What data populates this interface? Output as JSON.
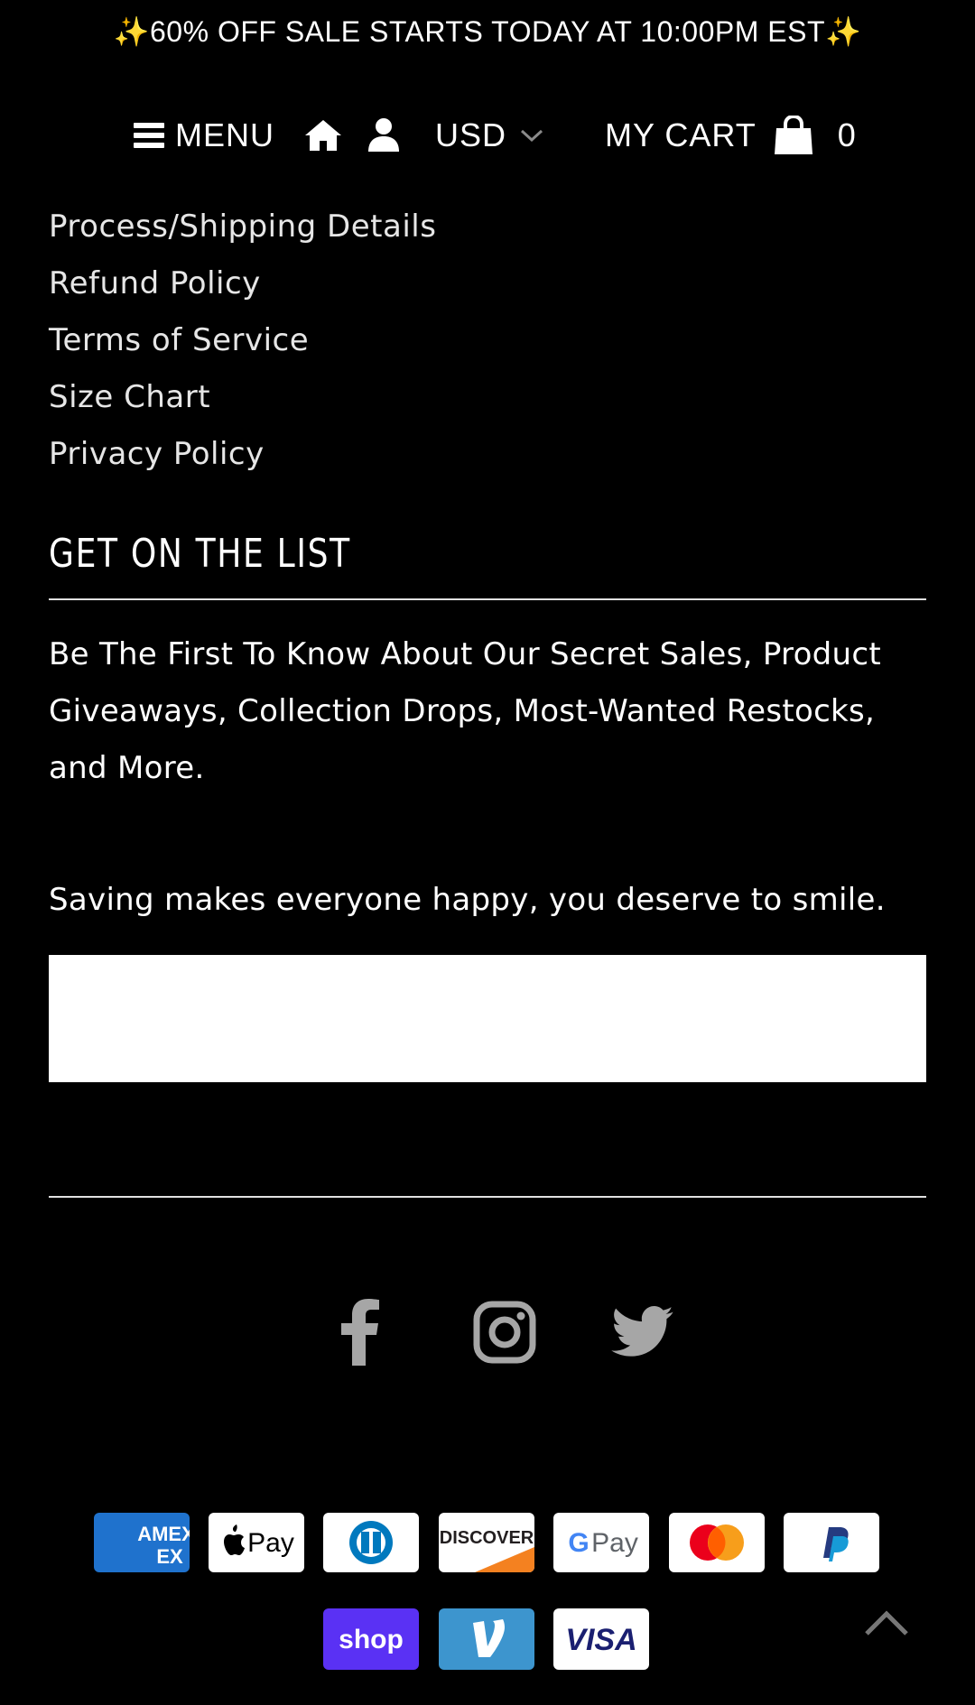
{
  "announcement": {
    "text": "60% OFF SALE STARTS TODAY AT 10:00PM EST",
    "emoji": "✨"
  },
  "header": {
    "menu_label": "MENU",
    "currency": "USD",
    "cart_label": "MY CART",
    "cart_count": "0"
  },
  "footer_links": [
    "Process/Shipping Details",
    "Refund Policy",
    "Terms of Service",
    "Size Chart",
    "Privacy Policy"
  ],
  "newsletter": {
    "title": "GET ON THE LIST",
    "description": "Be The First To Know About Our Secret Sales, Product Giveaways, Collection Drops, Most-Wanted Restocks, and More.",
    "tagline": "Saving makes everyone happy, you deserve to smile.",
    "email_value": ""
  },
  "social": [
    "facebook-icon",
    "instagram-icon",
    "twitter-icon"
  ],
  "payments": {
    "amex": "AMEX",
    "applepay": "Pay",
    "discover": "DISCOVER",
    "googlepay": "Pay",
    "shoppay": "shop",
    "visa": "VISA"
  },
  "colors": {
    "background": "#000000",
    "text": "#ffffff",
    "link_text": "#e6e6e6",
    "social_icon": "#a6a6a6",
    "sparkle": "#f7d64a"
  }
}
